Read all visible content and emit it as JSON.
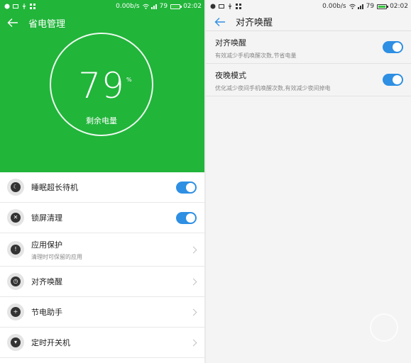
{
  "left": {
    "status": {
      "speed": "0.00b/s",
      "battery": "79",
      "time": "02:02"
    },
    "title": "省电管理",
    "battery_gauge": {
      "value": "79",
      "unit": "%",
      "caption": "剩余电量"
    },
    "items": [
      {
        "label": "睡眠超长待机",
        "sub": "",
        "control": "toggle",
        "on": true,
        "icon": "sleep-icon"
      },
      {
        "label": "锁屏清理",
        "sub": "",
        "control": "toggle",
        "on": true,
        "icon": "lock-clean-icon"
      },
      {
        "label": "应用保护",
        "sub": "清理时可保留的应用",
        "control": "chevron",
        "icon": "shield-icon"
      },
      {
        "label": "对齐唤醒",
        "sub": "",
        "control": "chevron",
        "icon": "clock-icon"
      },
      {
        "label": "节电助手",
        "sub": "",
        "control": "chevron",
        "icon": "battery-assist-icon"
      },
      {
        "label": "定时开关机",
        "sub": "",
        "control": "chevron",
        "icon": "power-timer-icon"
      }
    ]
  },
  "right": {
    "status": {
      "speed": "0.00b/s",
      "battery": "79",
      "time": "02:02"
    },
    "title": "对齐唤醒",
    "items": [
      {
        "label": "对齐唤醒",
        "sub": "有效减少手机唤醒次数,节省电量",
        "on": true
      },
      {
        "label": "夜晚模式",
        "sub": "优化减少夜间手机唤醒次数,有效减少夜间掉电",
        "on": true
      }
    ]
  },
  "colors": {
    "accent_green": "#21b53a",
    "toggle_blue": "#2e8fe3"
  }
}
